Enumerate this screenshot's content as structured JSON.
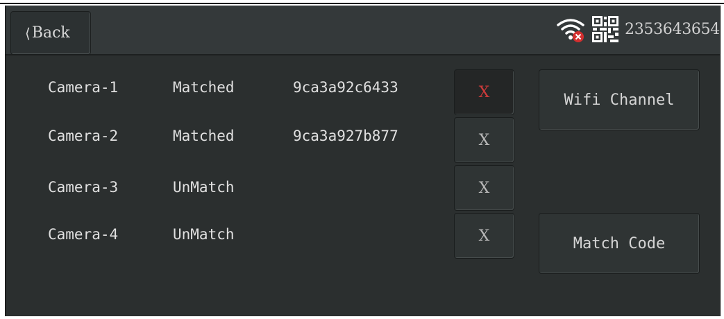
{
  "header": {
    "back_label": "Back",
    "device_id": "2353643654",
    "wifi_status_icon": "wifi-disconnected-icon",
    "qr_icon": "qr-code-icon"
  },
  "cameras": [
    {
      "name": "Camera-1",
      "status": "Matched",
      "code": "9ca3a92c6433",
      "delete_label": "X",
      "active": true
    },
    {
      "name": "Camera-2",
      "status": "Matched",
      "code": "9ca3a927b877",
      "delete_label": "X",
      "active": false
    },
    {
      "name": "Camera-3",
      "status": "UnMatch",
      "code": "",
      "delete_label": "X",
      "active": false
    },
    {
      "name": "Camera-4",
      "status": "UnMatch",
      "code": "",
      "delete_label": "X",
      "active": false
    }
  ],
  "actions": {
    "wifi_channel_label": "Wifi Channel",
    "match_code_label": "Match Code"
  },
  "colors": {
    "background": "#2b2f2f",
    "header": "#34393a",
    "active_x": "#cc3a3a",
    "wifi_error": "#d32f2f"
  }
}
